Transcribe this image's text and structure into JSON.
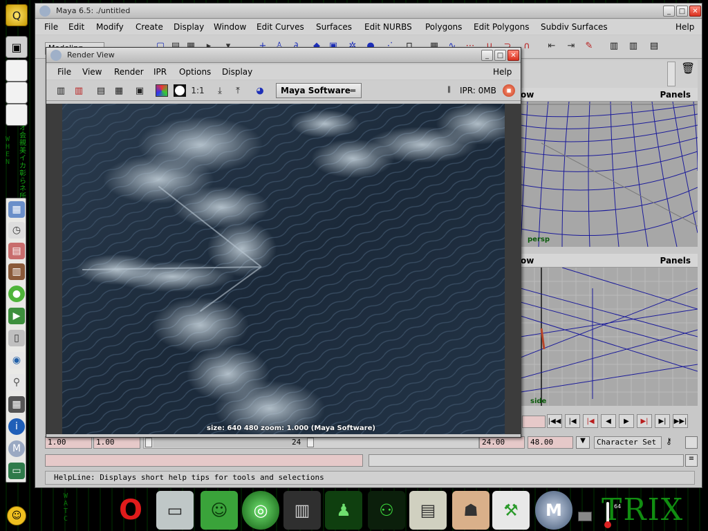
{
  "desktop": {
    "matrix_text_a": "オ会親美イカ彰らネ所の",
    "matrix_text_b": "WHEN",
    "matrix_text_c": "WATC",
    "matrix_logo": "TRIX",
    "temperature": "64"
  },
  "maya_window": {
    "title": "Maya 6.5: ./untitled",
    "menus": [
      "File",
      "Edit",
      "Modify",
      "Create",
      "Display",
      "Window",
      "Edit Curves",
      "Surfaces",
      "Edit NURBS",
      "Polygons",
      "Edit Polygons",
      "Subdiv Surfaces",
      "Help"
    ],
    "mode": "Modeling",
    "viewport_top": {
      "title_fragment": "ow",
      "panels_label": "Panels",
      "camera_label": "persp"
    },
    "viewport_bottom": {
      "title_fragment": "ow",
      "panels_label": "Panels",
      "camera_label": "side"
    },
    "range": {
      "start": "1.00",
      "start2": "1.00",
      "slider_start": "1",
      "slider_end": "24",
      "end": "24.00",
      "end2": "48.00",
      "character_set": "Character Set"
    },
    "helpline": "HelpLine: Displays short help tips for tools and selections"
  },
  "render_view": {
    "title": "Render View",
    "menus": [
      "File",
      "View",
      "Render",
      "IPR",
      "Options",
      "Display"
    ],
    "help": "Help",
    "ratio_label": "1:1",
    "renderer": "Maya Software",
    "ipr_memory": "IPR: 0MB",
    "image_info": "size:  640  480 zoom: 1.000  (Maya Software)"
  },
  "colors": {
    "wire_blue": "#1a1a9a",
    "grid_gray": "#a9a9a9",
    "matrix_green": "#1bd21b",
    "close_red": "#d9311f"
  }
}
